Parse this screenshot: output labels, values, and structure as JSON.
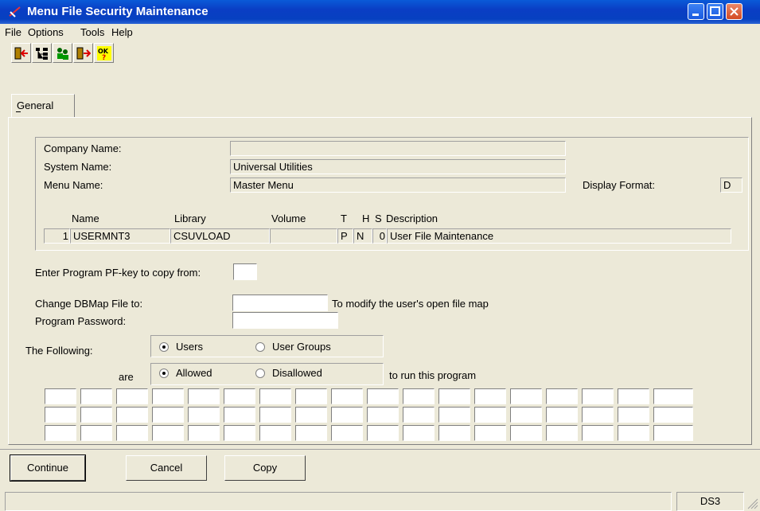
{
  "window": {
    "title": "Menu File Security Maintenance"
  },
  "menu": {
    "items": [
      "File",
      "Options",
      "Tools",
      "Help"
    ]
  },
  "toolbar": {
    "icons": [
      "exit-icon",
      "tree-icon",
      "users-icon",
      "next-icon",
      "ok-help-icon"
    ]
  },
  "tab": {
    "general_label": "General"
  },
  "info": {
    "company_name_label": "Company Name:",
    "company_name_value": "",
    "system_name_label": "System Name:",
    "system_name_value": "Universal Utilities",
    "menu_name_label": "Menu Name:",
    "menu_name_value": "Master Menu",
    "display_format_label": "Display Format:",
    "display_format_value": "D"
  },
  "program": {
    "headers": {
      "name": "Name",
      "library": "Library",
      "volume": "Volume",
      "t": "T",
      "h": "H",
      "s": "S",
      "description": "Description"
    },
    "row": {
      "num": "1",
      "name": "USERMNT3",
      "library": "CSUVLOAD",
      "volume": "",
      "t": "P",
      "h": "N",
      "s": "0",
      "description": "User File Maintenance"
    }
  },
  "form": {
    "pfkey_label": "Enter Program PF-key to copy from:",
    "pfkey_value": "",
    "dbmap_label": "Change DBMap File to:",
    "dbmap_value": "",
    "dbmap_hint": "To modify the user's open file map",
    "password_label": "Program Password:",
    "password_value": "",
    "following_label": "The Following:",
    "users_label": "Users",
    "user_groups_label": "User Groups",
    "are_label": "are",
    "allowed_label": "Allowed",
    "disallowed_label": "Disallowed",
    "run_hint": "to run this program"
  },
  "buttons": {
    "continue": "Continue",
    "cancel": "Cancel",
    "copy": "Copy"
  },
  "status": {
    "text": "",
    "code": "DS3"
  },
  "colors": {
    "titlebar": "#0a3ec4",
    "window_bg": "#ece9d8"
  }
}
